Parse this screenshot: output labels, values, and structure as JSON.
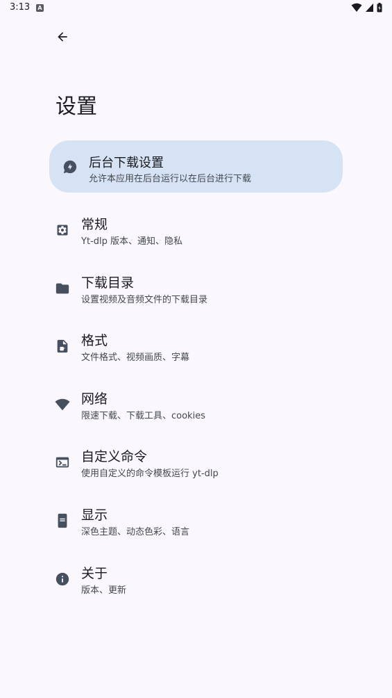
{
  "status_bar": {
    "time": "3:13",
    "app_icon_letter": "A"
  },
  "header": {
    "back_icon": "arrow-back-icon",
    "title": "设置"
  },
  "highlight": {
    "icon": "offline-bolt-icon",
    "title": "后台下载设置",
    "description": "允许本应用在后台运行以在后台进行下载",
    "color": "#d5e3f5"
  },
  "items": [
    {
      "icon": "settings-gear-icon",
      "title": "常规",
      "description": "Yt-dlp 版本、通知、隐私"
    },
    {
      "icon": "folder-icon",
      "title": "下载目录",
      "description": "设置视频及音频文件的下载目录"
    },
    {
      "icon": "video-file-icon",
      "title": "格式",
      "description": "文件格式、视频画质、字幕"
    },
    {
      "icon": "wifi-icon",
      "title": "网络",
      "description": "限速下载、下载工具、cookies"
    },
    {
      "icon": "terminal-icon",
      "title": "自定义命令",
      "description": "使用自定义的命令模板运行 yt-dlp"
    },
    {
      "icon": "display-icon",
      "title": "显示",
      "description": "深色主题、动态色彩、语言"
    },
    {
      "icon": "info-icon",
      "title": "关于",
      "description": "版本、更新"
    }
  ],
  "colors": {
    "background": "#fbf8fd",
    "icon": "#46505f",
    "text_primary": "#1b1b1f",
    "text_secondary": "#43474e"
  }
}
